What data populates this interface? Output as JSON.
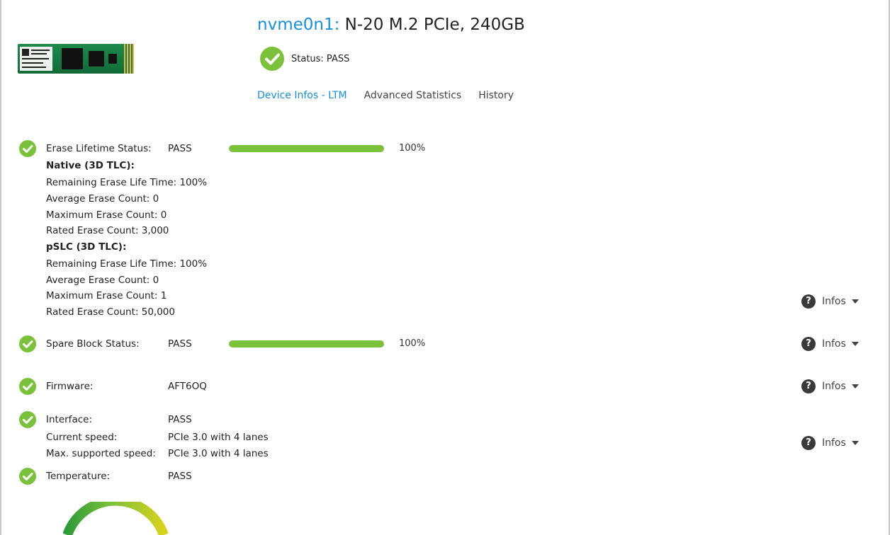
{
  "header": {
    "device_id": "nvme0n1:",
    "device_model": " N-20 M.2 PCIe, 240GB",
    "status_text": "Status: PASS"
  },
  "tabs": [
    {
      "label": "Device Infos - LTM",
      "active": true
    },
    {
      "label": "Advanced Statistics",
      "active": false
    },
    {
      "label": "History",
      "active": false
    }
  ],
  "erase": {
    "title": "Erase Lifetime Status:",
    "value": "PASS",
    "progress_fraction": 1.0,
    "progress_text": "100%",
    "native_heading": "Native (3D TLC):",
    "native_lines": [
      "Remaining Erase Life Time: 100%",
      "Average Erase Count: 0",
      "Maximum Erase Count: 0",
      "Rated Erase Count: 3,000"
    ],
    "pslc_heading": "pSLC (3D TLC):",
    "pslc_lines": [
      "Remaining Erase Life Time: 100%",
      "Average Erase Count: 0",
      "Maximum Erase Count: 1",
      "Rated Erase Count: 50,000"
    ]
  },
  "spare": {
    "title": "Spare Block Status:",
    "value": "PASS",
    "progress_fraction": 1.0,
    "progress_text": "100%"
  },
  "firmware": {
    "title": "Firmware:",
    "value": "AFT6OQ"
  },
  "interface": {
    "title": "Interface:",
    "value": "PASS",
    "current_label": "Current speed:",
    "current_value": "PCIe 3.0 with 4 lanes",
    "max_label": "Max. supported speed:",
    "max_value": "PCIe 3.0 with 4 lanes"
  },
  "temperature": {
    "title": "Temperature:",
    "value": "PASS"
  },
  "infos_label": "Infos",
  "colors": {
    "accent": "#1a8fd6",
    "pass_green": "#7cc13b",
    "gauge_yellow": "#d8d21e"
  },
  "icons": [
    "check-icon",
    "help-icon",
    "caret-down-icon",
    "ssd-image"
  ]
}
